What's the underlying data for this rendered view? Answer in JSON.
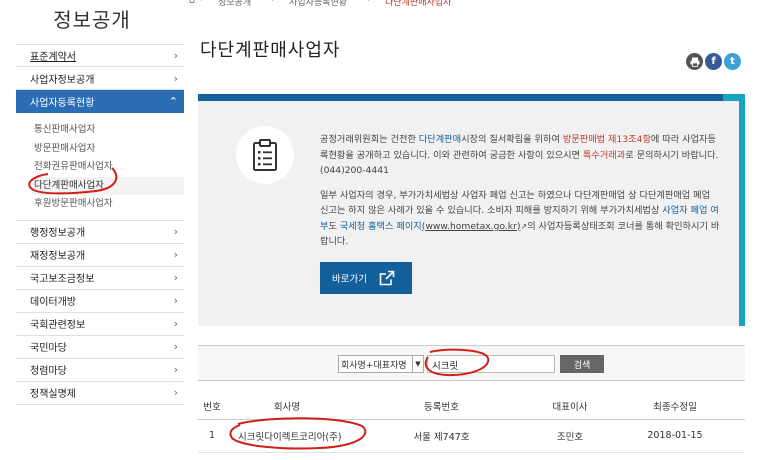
{
  "sidebar": {
    "title": "정보공개",
    "items": [
      {
        "label": "표준계약서",
        "active": false
      },
      {
        "label": "사업자정보공개",
        "active": false
      },
      {
        "label": "사업자등록현황",
        "active": true
      }
    ],
    "sub_items": [
      "통신판매사업자",
      "방문판매사업자",
      "전화권유판매사업자",
      "다단계판매사업자",
      "후원방문판매사업자"
    ],
    "more_items": [
      "행정정보공개",
      "재정정보공개",
      "국고보조금정보",
      "데이터개방",
      "국회관련정보",
      "국민마당",
      "청렴마당",
      "정책실명제"
    ]
  },
  "breadcrumb": {
    "items": [
      "정보공개",
      "사업자등록현황",
      "다단계판매사업자"
    ]
  },
  "main": {
    "title": "다단계판매사업자",
    "share_icons": {
      "print": "print-icon",
      "facebook": "f",
      "twitter": "t"
    },
    "info": {
      "p1_a": "공정거래위원회는 건전한 ",
      "p1_b": "다단계판매",
      "p1_c": "시장의 질서확립을 위하여 ",
      "p1_d": "방문판매법 제13조4항",
      "p1_e": "에 따라 사업자등록현황을 공개하고 있습니다. 이와 관련하여 궁금한 사항이 있으시면 ",
      "p1_f": "특수거래과",
      "p1_g": "로 문의하시기 바랍니다. (044)200-4441",
      "p2_a": "일부 사업자의 경우, 부가가치세법상 사업자 폐업 신고는 하였으나 다단계판매업 상 다단계판매업 폐업 신고는 하지 않은 사례가 있을 수 있습니다. 소비자 피해를 방지하기 위해 부가가치세법상 ",
      "p2_b": "사업자 폐업 여부",
      "p2_c": "도 ",
      "p2_d": "국세청 홈택스 페이지",
      "p2_e": "(www.hometax.go.kr)",
      "p2_f": "의 사업자등록상태조회 코너를 통해 확인하시기 바랍니다.",
      "button": "바로가기"
    },
    "search": {
      "select_value": "회사명+대표자명",
      "input_value": "시크릿",
      "button": "검색"
    },
    "table": {
      "headers": [
        "번호",
        "회사명",
        "등록번호",
        "대표이사",
        "최종수정일"
      ],
      "rows": [
        {
          "no": "1",
          "name": "시크릿다이렉트코리아(주)",
          "reg": "서울 제747호",
          "ceo": "조민호",
          "date": "2018-01-15"
        }
      ]
    }
  },
  "colors": {
    "accent": "#2a6db5",
    "box_bar": "#14609b",
    "teal": "#17a4c0",
    "annotation": "#d0201a"
  }
}
